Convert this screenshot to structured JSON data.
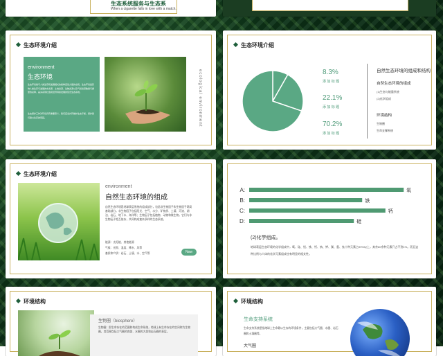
{
  "colors": {
    "accent": "#5aa884",
    "dark_green": "#1e5e3a",
    "gold": "#c9b15e"
  },
  "slide1": {
    "tagline_cn": "生态系统服务与生态系",
    "tagline_en": "When a cigarette falls in love with a match."
  },
  "slide3": {
    "section_title": "生态环境介绍",
    "card_en": "environment",
    "card_cn": "生态环境",
    "card_para1": "生态环境指与人类生存和发展相关的各种自然力量的总和。生态环境是影响人类生存与发展的水资源、土地资源、生物资源以及气候资源数量与质量的总称，是关系到社会和经济持续发展的复合生态系统。",
    "card_para2": "生态保护工作对环境具有重要意义，我们应当共同维护生态平衡，保护我们赖以生存的家园。",
    "vertical_text": "ecological environment"
  },
  "slide4": {
    "section_title": "生态环境介绍",
    "chart_data": {
      "type": "pie",
      "values": [
        8.3,
        22.1,
        70.2
      ],
      "labels": [
        "8.3%",
        "22.1%",
        "70.2%"
      ],
      "captions": [
        "添 加 标 题",
        "添 加 标 题",
        "添 加 标 题"
      ],
      "colors": [
        "#5aa884",
        "#5aa884",
        "#5aa884"
      ]
    },
    "right_title": "自然生态环境的组成和结构",
    "group1_title": "自然生态环境的组成",
    "group1_items": [
      "(1)生态与能量系统",
      "(2)化学组成"
    ],
    "group2_title": "环境结构",
    "group2_items": [
      "生物圈",
      "生命支撑系统"
    ]
  },
  "slide5": {
    "section_title": "生态环境介绍",
    "heading_en": "environment",
    "heading_cn": "自然生态环境的组成",
    "paragraph": "自然生态环境是地球表层系统的组成部分，包括非生物因子和生物因子两类基础部分。非生物因子包括阳光、空气、水分、矿物质、土壤、河流、湖泊、岩石、地下水、海洋等；生物因子包括植物、动物和微生物，它们与非生物因子相互依存，共同构成复杂多样的生态系统。",
    "bullets": [
      "能源：太阳能、其他能源",
      "气候：光照、温度、降水、风等",
      "基质和介质：岩石、土壤、水、空气等"
    ],
    "button_label": "Now"
  },
  "slide6": {
    "chart_data": {
      "type": "bar",
      "orientation": "horizontal",
      "categories": [
        "A:",
        "B:",
        "C:",
        "D:"
      ],
      "values": [
        93,
        68,
        82,
        63
      ],
      "labels": [
        "氧",
        "铁",
        "钙",
        "硅"
      ],
      "xlim": [
        0,
        100
      ]
    },
    "subheading": "(2)化学组成。",
    "paragraph": "地球表层生态环境的化学组成中，氧、硅、铝、铁、钙、钠、钾、镁、氢、钛十种元素占99%以上，其余80余种元素只占不到1%。而且这种比例与人体的化学元素组成也有明显的相关性。"
  },
  "slide7": {
    "section_title": "环境结构",
    "label": "生物圈（biosphere）",
    "paragraph": "生物圈：即生命存在的范围和构成生命系统，地球上有生命存在的空间称为生物圈，其范围包括大气圈的底部、水圈的大部和岩石圈的表层。"
  },
  "slide8": {
    "section_title": "环境结构",
    "subtitle": "生命支持系统",
    "paragraph": "生命支持系统是指地球上生命赖以生存的环境条件，主要包括大气圈、水圈、岩石圈和土壤圈等。",
    "bottom_label": "大气圈"
  }
}
